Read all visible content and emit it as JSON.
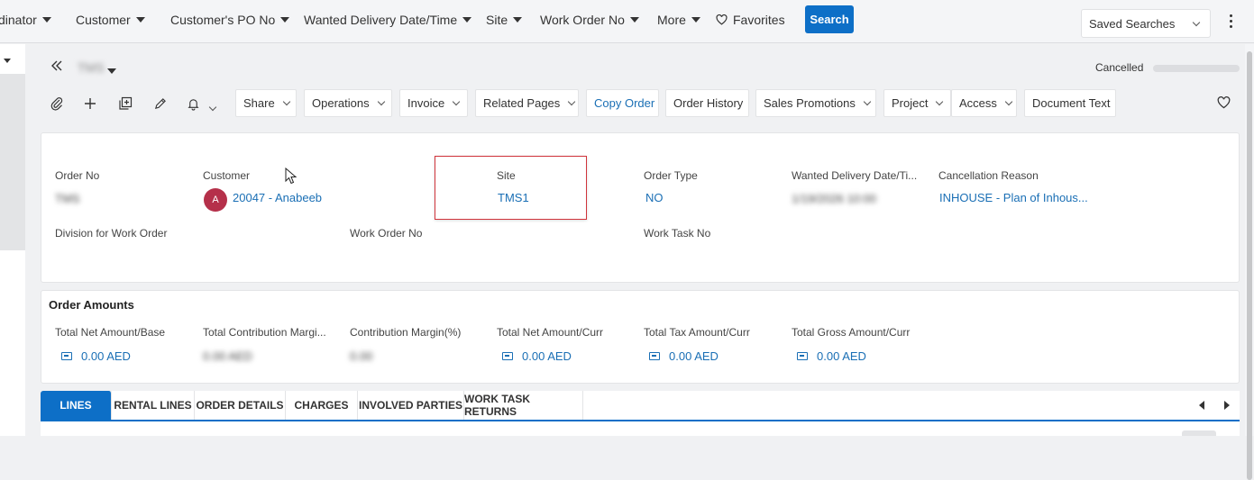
{
  "filters": [
    {
      "label": "dinator",
      "name": "coordinator"
    },
    {
      "label": "Customer",
      "name": "customer"
    },
    {
      "label": "Customer's PO No",
      "name": "customer-po-no"
    },
    {
      "label": "Wanted Delivery Date/Time",
      "name": "wanted-delivery-date"
    },
    {
      "label": "Site",
      "name": "site"
    },
    {
      "label": "Work Order No",
      "name": "work-order-no"
    },
    {
      "label": "More",
      "name": "more"
    }
  ],
  "favorites_label": "Favorites",
  "search_label": "Search",
  "saved_searches_label": "Saved Searches",
  "record_title": "TMS",
  "status": "Cancelled",
  "toolbar": {
    "share": "Share",
    "operations": "Operations",
    "invoice": "Invoice",
    "related_pages": "Related Pages",
    "copy_order": "Copy Order",
    "order_history": "Order History",
    "sales_promotions": "Sales Promotions",
    "project": "Project",
    "access": "Access",
    "document_text": "Document Text"
  },
  "details": {
    "order_no_label": "Order No",
    "order_no_value": "TMS",
    "customer_label": "Customer",
    "customer_avatar": "A",
    "customer_value": "20047 - Anabeeb",
    "site_label": "Site",
    "site_value": "TMS1",
    "order_type_label": "Order Type",
    "order_type_value": "NO",
    "wanted_delivery_label": "Wanted Delivery Date/Ti...",
    "wanted_delivery_value": "1/19/2026 10:00",
    "cancellation_label": "Cancellation Reason",
    "cancellation_value": "INHOUSE - Plan of Inhous...",
    "division_label": "Division for Work Order",
    "work_order_no_label": "Work Order No",
    "work_task_no_label": "Work Task No"
  },
  "amounts": {
    "title": "Order Amounts",
    "total_net_base_label": "Total Net Amount/Base",
    "total_net_base_value": "0.00 AED",
    "total_contribution_label": "Total Contribution Margi...",
    "total_contribution_value": "0.00 AED",
    "contribution_pct_label": "Contribution Margin(%)",
    "contribution_pct_value": "0.00",
    "total_net_curr_label": "Total Net Amount/Curr",
    "total_net_curr_value": "0.00 AED",
    "total_tax_curr_label": "Total Tax Amount/Curr",
    "total_tax_curr_value": "0.00 AED",
    "total_gross_curr_label": "Total Gross Amount/Curr",
    "total_gross_curr_value": "0.00 AED"
  },
  "tabs": [
    {
      "label": "LINES",
      "name": "tab-lines"
    },
    {
      "label": "RENTAL LINES",
      "name": "tab-rental-lines"
    },
    {
      "label": "ORDER DETAILS",
      "name": "tab-order-details"
    },
    {
      "label": "CHARGES",
      "name": "tab-charges"
    },
    {
      "label": "INVOLVED PARTIES",
      "name": "tab-involved-parties"
    },
    {
      "label": "WORK TASK RETURNS",
      "name": "tab-work-task-returns"
    }
  ],
  "colors": {
    "accent": "#0d6fc7",
    "link": "#1a6fb5",
    "highlight_border": "#d0343b",
    "avatar_bg": "#b5304a"
  }
}
